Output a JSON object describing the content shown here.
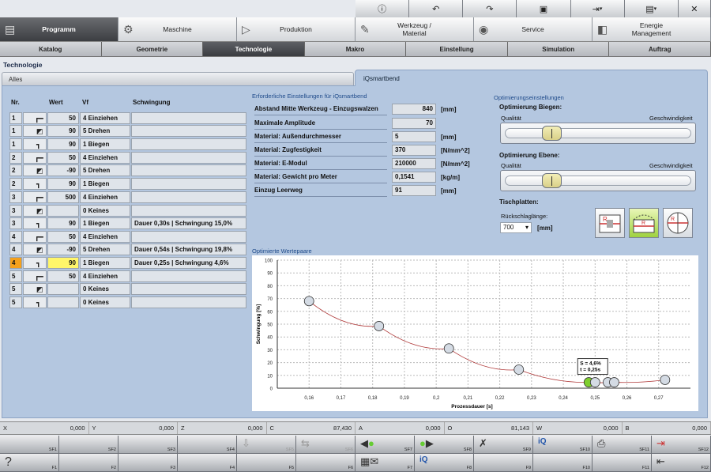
{
  "toolbar_icons": [
    "info-icon",
    "undo-icon",
    "redo-icon",
    "machine-settings-icon",
    "export-icon",
    "save-icon",
    "close-icon"
  ],
  "main_nav": [
    {
      "label": "Programm",
      "icon": "document-icon",
      "active": true
    },
    {
      "label": "Maschine",
      "icon": "gears-icon",
      "active": false
    },
    {
      "label": "Produktion",
      "icon": "production-icon",
      "active": false
    },
    {
      "label": "Werkzeug /\nMaterial",
      "icon": "wrench-icon",
      "active": false
    },
    {
      "label": "Service",
      "icon": "eye-icon",
      "active": false
    },
    {
      "label": "Energie\nManagement",
      "icon": "leaf-icon",
      "active": false
    }
  ],
  "sub_tabs": [
    {
      "label": "Katalog",
      "active": false
    },
    {
      "label": "Geometrie",
      "active": false
    },
    {
      "label": "Technologie",
      "active": true
    },
    {
      "label": "Makro",
      "active": false
    },
    {
      "label": "Einstellung",
      "active": false
    },
    {
      "label": "Simulation",
      "active": false
    },
    {
      "label": "Auftrag",
      "active": false
    }
  ],
  "breadcrumb": "Technologie",
  "panel_tabs": {
    "alles": "Alles",
    "iq": "iQsmartbend"
  },
  "table": {
    "headers": {
      "nr": "Nr.",
      "wert": "Wert",
      "vf": "Vf",
      "schwingung": "Schwingung"
    },
    "rows": [
      {
        "nr": "1",
        "icon": "segment-bend-icon",
        "wert": "50",
        "vf": "4 Einziehen",
        "schwingung": ""
      },
      {
        "nr": "1",
        "icon": "rotate-icon",
        "wert": "90",
        "vf": "5 Drehen",
        "schwingung": ""
      },
      {
        "nr": "1",
        "icon": "bend-icon",
        "wert": "90",
        "vf": "1 Biegen",
        "schwingung": ""
      },
      {
        "nr": "2",
        "icon": "segment-bend-icon",
        "wert": "50",
        "vf": "4 Einziehen",
        "schwingung": ""
      },
      {
        "nr": "2",
        "icon": "rotate-icon",
        "wert": "-90",
        "vf": "5 Drehen",
        "schwingung": ""
      },
      {
        "nr": "2",
        "icon": "bend-icon",
        "wert": "90",
        "vf": "1 Biegen",
        "schwingung": ""
      },
      {
        "nr": "3",
        "icon": "segment-bend-icon",
        "wert": "500",
        "vf": "4 Einziehen",
        "schwingung": ""
      },
      {
        "nr": "3",
        "icon": "rotate-icon",
        "wert": "",
        "vf": "0 Keines",
        "schwingung": ""
      },
      {
        "nr": "3",
        "icon": "bend-icon",
        "wert": "90",
        "vf": "1 Biegen",
        "schwingung": "Dauer 0,30s | Schwingung 15,0%"
      },
      {
        "nr": "4",
        "icon": "segment-bend-icon",
        "wert": "50",
        "vf": "4 Einziehen",
        "schwingung": ""
      },
      {
        "nr": "4",
        "icon": "rotate-icon",
        "wert": "-90",
        "vf": "5 Drehen",
        "schwingung": "Dauer 0,54s | Schwingung 19,8%"
      },
      {
        "nr": "4",
        "icon": "bend-icon",
        "wert": "90",
        "vf": "1 Biegen",
        "schwingung": "Dauer 0,25s | Schwingung 4,6%",
        "selected": true
      },
      {
        "nr": "5",
        "icon": "segment-bend-icon",
        "wert": "50",
        "vf": "4 Einziehen",
        "schwingung": ""
      },
      {
        "nr": "5",
        "icon": "rotate-icon",
        "wert": "",
        "vf": "0 Keines",
        "schwingung": ""
      },
      {
        "nr": "5",
        "icon": "bend-icon",
        "wert": "",
        "vf": "0 Keines",
        "schwingung": ""
      }
    ]
  },
  "required": {
    "heading": "Erforderliche Einstellungen für iQsmartbend",
    "rows": [
      {
        "label": "Abstand Mitte Werkzeug - Einzugswalzen",
        "value": "840",
        "unit": "[mm]"
      },
      {
        "label": "Maximale Amplitude",
        "value": "70",
        "unit": ""
      },
      {
        "label": "Material: Außendurchmesser",
        "value": "5",
        "unit": "[mm]"
      },
      {
        "label": "Material: Zugfestigkeit",
        "value": "370",
        "unit": "[N/mm^2]"
      },
      {
        "label": "Material: E-Modul",
        "value": "210000",
        "unit": "[N/mm^2]"
      },
      {
        "label": "Material: Gewicht pro Meter",
        "value": "0,1541",
        "unit": "[kg/m]"
      },
      {
        "label": "Einzug Leerweg",
        "value": "91",
        "unit": "[mm]"
      }
    ]
  },
  "optimization": {
    "heading": "Optimierungseinstellungen",
    "bend_title": "Optimierung Biegen:",
    "plane_title": "Optimierung Ebene:",
    "left_label": "Qualität",
    "right_label": "Geschwindigkeit",
    "bend_level": 0.25,
    "plane_level": 0.25,
    "plates_title": "Tischplatten:",
    "stroke_label": "Rückschlaglänge:",
    "stroke_value": "700",
    "stroke_unit": "[mm]",
    "plates_icons": [
      "plate-horizontal-icon",
      "plate-active-icon",
      "plate-circle-icon"
    ]
  },
  "chart_heading": "Optimierte Wertepaare",
  "chart_data": {
    "type": "scatter",
    "xlabel": "Prozessdauer [s]",
    "ylabel": "Schwingung [%]",
    "xlim": [
      0.15,
      0.28
    ],
    "ylim": [
      0,
      100
    ],
    "x_ticks": [
      "0,16",
      "0,17",
      "0,18",
      "0,19",
      "0,2",
      "0,21",
      "0,22",
      "0,23",
      "0,24",
      "0,25",
      "0,26",
      "0,27"
    ],
    "y_ticks": [
      "0",
      "10",
      "20",
      "30",
      "40",
      "50",
      "60",
      "70",
      "80",
      "90",
      "100"
    ],
    "points": [
      [
        0.16,
        68
      ],
      [
        0.182,
        48.5
      ],
      [
        0.204,
        31
      ],
      [
        0.226,
        14.5
      ],
      [
        0.248,
        4.6
      ],
      [
        0.25,
        4.6
      ],
      [
        0.254,
        4.6
      ],
      [
        0.256,
        4.6
      ],
      [
        0.272,
        6.5
      ]
    ],
    "selected_index": 4,
    "tooltip": [
      "S = 4,6%",
      "t = 0,25s"
    ]
  },
  "status": [
    {
      "axis": "X",
      "value": "0,000"
    },
    {
      "axis": "Y",
      "value": "0,000"
    },
    {
      "axis": "Z",
      "value": "0,000"
    },
    {
      "axis": "C",
      "value": "87,430"
    },
    {
      "axis": "A",
      "value": "0,000"
    },
    {
      "axis": "O",
      "value": "81,143"
    },
    {
      "axis": "W",
      "value": "0,000"
    },
    {
      "axis": "B",
      "value": "0,000"
    }
  ],
  "softkeys_shift": [
    "SF1",
    "SF2",
    "SF3",
    "SF4",
    "SF5",
    "SF6",
    "SF7",
    "SF8",
    "SF9",
    "SF10",
    "SF11",
    "SF12"
  ],
  "softkeys_f": [
    "F1",
    "F2",
    "F3",
    "F4",
    "F5",
    "F6",
    "F7",
    "F8",
    "F9",
    "F10",
    "F11",
    "F12"
  ]
}
